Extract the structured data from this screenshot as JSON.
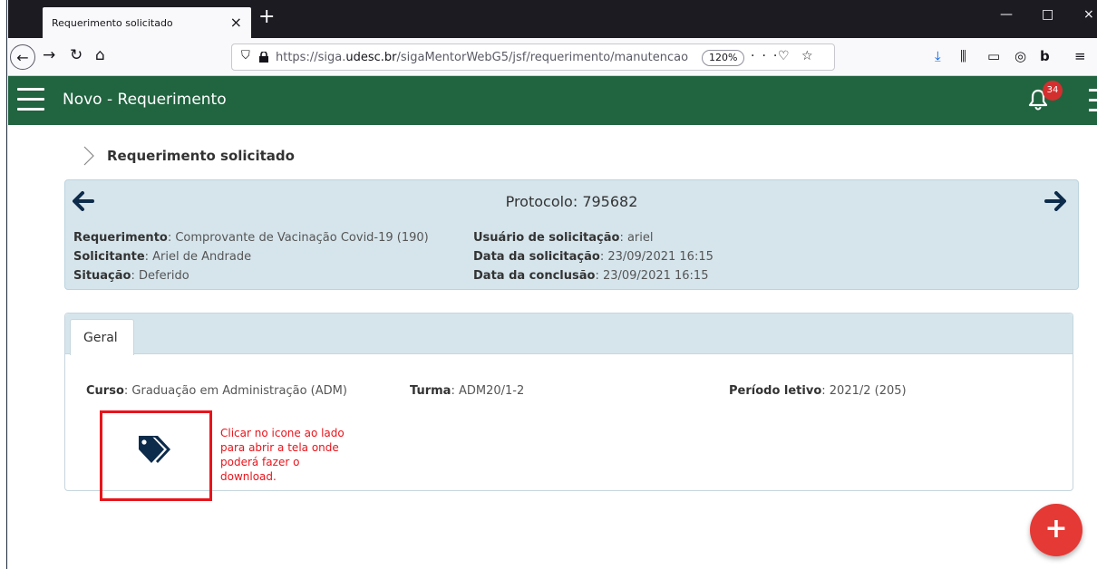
{
  "browser": {
    "tab_title": "Requerimento solicitado",
    "tab_close": "×",
    "new_tab": "+",
    "window_min": "—",
    "window_max": "□",
    "window_close": "×",
    "url_prefix": "https://siga.",
    "url_domain": "udesc.br",
    "url_rest": "/sigaMentorWebG5/jsf/requerimento/manutencao",
    "zoom": "120%",
    "icons": [
      "back-icon",
      "forward-icon",
      "reload-icon",
      "home-icon",
      "shield-icon",
      "lock-icon",
      "page-actions-icon",
      "pocket-icon",
      "bookmark-star-icon",
      "download-icon",
      "library-icon",
      "sidebar-icon",
      "extension-icon",
      "bitwarden-icon",
      "menu-icon"
    ]
  },
  "app": {
    "title": "Novo - Requerimento",
    "notifications_count": "34",
    "header_color": "#216440"
  },
  "breadcrumb": {
    "label": "Requerimento solicitado"
  },
  "protocol": {
    "title": "Protocolo: 795682",
    "left": [
      {
        "key": "Requerimento",
        "value": ": Comprovante de Vacinação Covid-19 (190)"
      },
      {
        "key": "Solicitante",
        "value": ": Ariel de Andrade"
      },
      {
        "key": "Situação",
        "value": ": Deferido"
      }
    ],
    "right": [
      {
        "key": "Usuário de solicitação",
        "value": ": ariel"
      },
      {
        "key": "Data da solicitação",
        "value": ": 23/09/2021 16:15"
      },
      {
        "key": "Data da conclusão",
        "value": ": 23/09/2021 16:15"
      }
    ]
  },
  "panel": {
    "tab_label": "Geral",
    "fields": [
      {
        "key": "Curso",
        "value": ": Graduação em Administração (ADM)"
      },
      {
        "key": "Turma",
        "value": ": ADM20/1-2"
      },
      {
        "key": "Período letivo",
        "value": ": 2021/2 (205)"
      }
    ],
    "annotation": "Clicar no icone ao lado para abrir a tela onde poderá fazer o download."
  },
  "fab": {
    "label": "+",
    "color": "#e53935"
  }
}
